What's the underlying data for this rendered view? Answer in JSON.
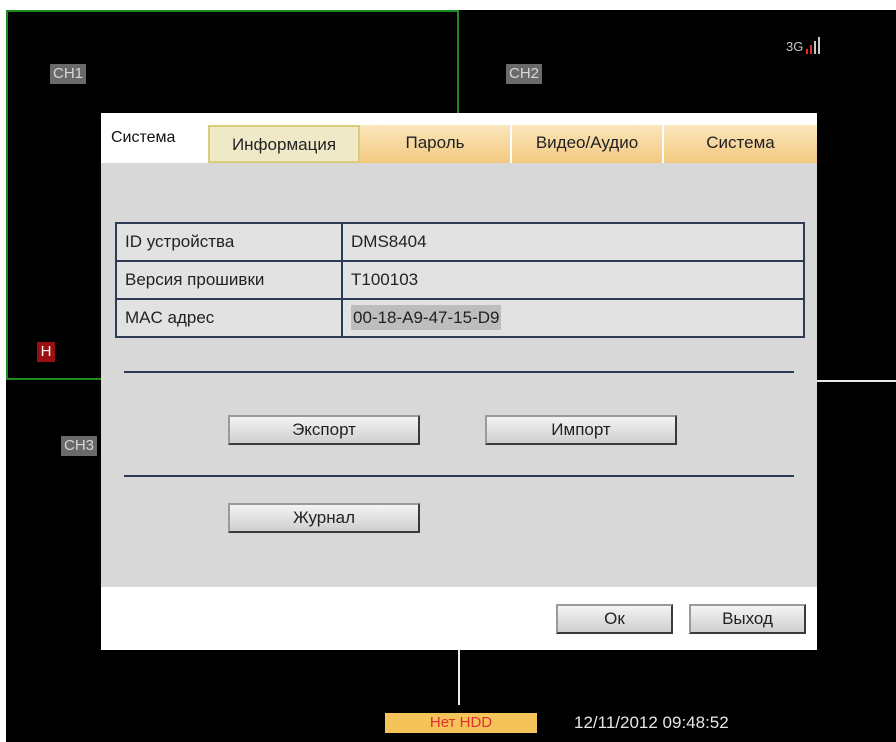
{
  "channels": {
    "ch1": "CH1",
    "ch2": "CH2",
    "ch3": "CH3"
  },
  "status": {
    "h_badge": "H",
    "network": "3G",
    "hdd": "Нет HDD",
    "datetime": "12/11/2012 09:48:52"
  },
  "dialog": {
    "title": "Система",
    "tabs": [
      {
        "label": "Информация",
        "active": true
      },
      {
        "label": "Пароль",
        "active": false
      },
      {
        "label": "Видео/Аудио",
        "active": false
      },
      {
        "label": "Система",
        "active": false
      }
    ],
    "info_rows": [
      {
        "label": "ID устройства",
        "value": "DMS8404"
      },
      {
        "label": "Версия прошивки",
        "value": "T100103"
      },
      {
        "label": "MAC адрес",
        "value": "00-18-A9-47-15-D9"
      }
    ],
    "buttons": {
      "export": "Экспорт",
      "import": "Импорт",
      "log": "Журнал",
      "ok": "Ок",
      "exit": "Выход"
    }
  },
  "colors": {
    "active_frame": "#1f8a1f",
    "tab_bg": "#f3c97f",
    "hdd_warning_bg": "#f4c45a",
    "hdd_warning_text": "#e03030",
    "table_border": "#2d3b55"
  }
}
